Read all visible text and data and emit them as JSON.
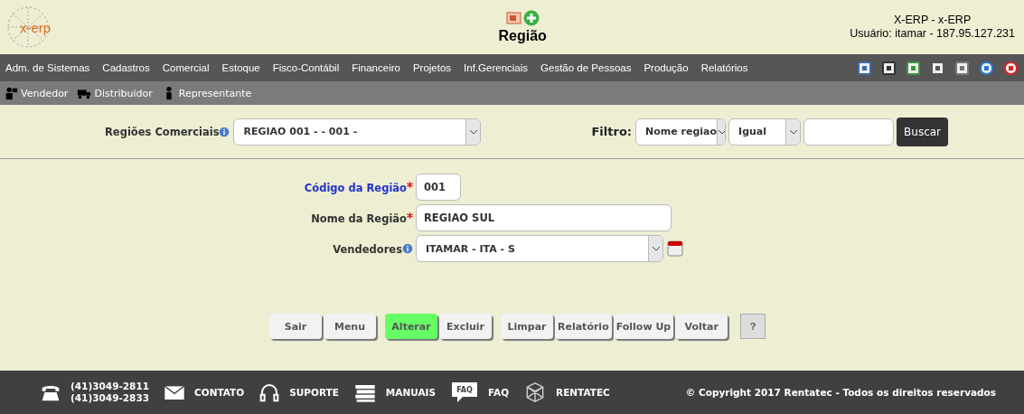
{
  "header": {
    "logo_text": "x-erp",
    "title": "Região",
    "system": "X-ERP - x-ERP",
    "user": "Usuário: itamar - 187.95.127.231"
  },
  "menu": [
    "Adm. de Sistemas",
    "Cadastros",
    "Comercial",
    "Estoque",
    "Fisco-Contábil",
    "Financeiro",
    "Projetos",
    "Inf.Gerenciais",
    "Gestão de Pessoas",
    "Produção",
    "Relatórios"
  ],
  "submenu": [
    {
      "label": "Vendedor",
      "kind": "seller"
    },
    {
      "label": "Distribuidor",
      "kind": "truck"
    },
    {
      "label": "Representante",
      "kind": "person"
    }
  ],
  "search": {
    "label": "Regiões Comerciais",
    "info": true,
    "value": "REGIAO 001 - - 001 -",
    "filter_label": "Filtro:",
    "field": "Nome regiao",
    "operator": "Igual",
    "button": "Buscar"
  },
  "form": [
    {
      "label": "Código da Região",
      "required": true,
      "info": false,
      "link": true,
      "kind": "short-text",
      "value": "001"
    },
    {
      "label": "Nome da Região",
      "required": true,
      "info": false,
      "link": false,
      "kind": "text",
      "value": "REGIAO SUL"
    },
    {
      "label": "Vendedores",
      "required": false,
      "info": true,
      "link": false,
      "kind": "select",
      "value": "ITAMAR - ITA - S"
    }
  ],
  "button_groups": [
    [
      {
        "label": "Sair",
        "highlighted": false
      },
      {
        "label": "Menu",
        "highlighted": false
      }
    ],
    [
      {
        "label": "Alterar",
        "highlighted": true
      },
      {
        "label": "Excluir",
        "highlighted": false
      }
    ],
    [
      {
        "label": "Limpar",
        "highlighted": false
      },
      {
        "label": "Relatório",
        "highlighted": false
      },
      {
        "label": "Follow Up",
        "highlighted": false
      },
      {
        "label": "Voltar",
        "highlighted": false
      }
    ]
  ],
  "help_button": "?",
  "footer": {
    "phones": [
      "(41)3049-2811",
      "(41)3049-2833"
    ],
    "links": [
      {
        "label": "CONTATO",
        "kind": "mail"
      },
      {
        "label": "SUPORTE",
        "kind": "headset"
      },
      {
        "label": "MANUAIS",
        "kind": "books"
      },
      {
        "label": "FAQ",
        "kind": "faq",
        "badge": "FAQ"
      },
      {
        "label": "RENTATEC",
        "kind": "cube"
      }
    ],
    "copyright": "© Copyright 2017 Rentatec - Todos os direitos reservados"
  }
}
